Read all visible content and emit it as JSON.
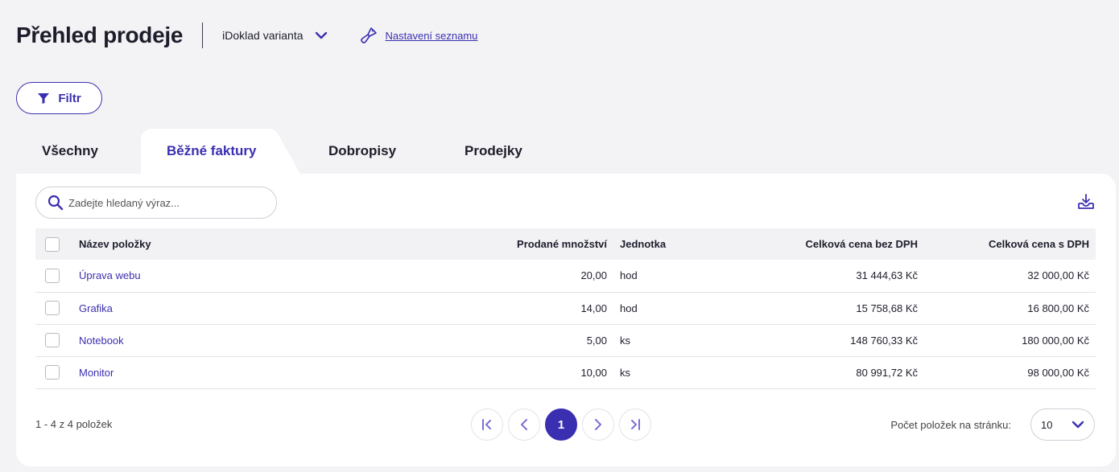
{
  "header": {
    "title": "Přehled prodeje",
    "variant_label": "iDoklad varianta",
    "settings_label": "Nastavení seznamu"
  },
  "filter": {
    "label": "Filtr"
  },
  "tabs": [
    {
      "label": "Všechny",
      "active": false
    },
    {
      "label": "Běžné faktury",
      "active": true
    },
    {
      "label": "Dobropisy",
      "active": false
    },
    {
      "label": "Prodejky",
      "active": false
    }
  ],
  "search": {
    "placeholder": "Zadejte hledaný výraz..."
  },
  "table": {
    "columns": {
      "name": "Název položky",
      "qty": "Prodané množství",
      "unit": "Jednotka",
      "net": "Celková cena bez DPH",
      "gross": "Celková cena s DPH"
    },
    "rows": [
      {
        "name": "Úprava webu",
        "qty": "20,00",
        "unit": "hod",
        "net": "31 444,63 Kč",
        "gross": "32 000,00 Kč"
      },
      {
        "name": "Grafika",
        "qty": "14,00",
        "unit": "hod",
        "net": "15 758,68 Kč",
        "gross": "16 800,00 Kč"
      },
      {
        "name": "Notebook",
        "qty": "5,00",
        "unit": "ks",
        "net": "148 760,33 Kč",
        "gross": "180 000,00 Kč"
      },
      {
        "name": "Monitor",
        "qty": "10,00",
        "unit": "ks",
        "net": "80 991,72 Kč",
        "gross": "98 000,00 Kč"
      }
    ]
  },
  "footer": {
    "count_text": "1 - 4 z 4 položek",
    "current_page": "1",
    "per_page_label": "Počet položek na stránku:",
    "per_page_value": "10"
  },
  "colors": {
    "accent": "#3a2fb0",
    "background": "#f3f3f6"
  },
  "icons": [
    "chevron-down-icon",
    "brush-icon",
    "filter-icon",
    "search-icon",
    "export-icon",
    "first-page-icon",
    "prev-page-icon",
    "next-page-icon",
    "last-page-icon"
  ]
}
